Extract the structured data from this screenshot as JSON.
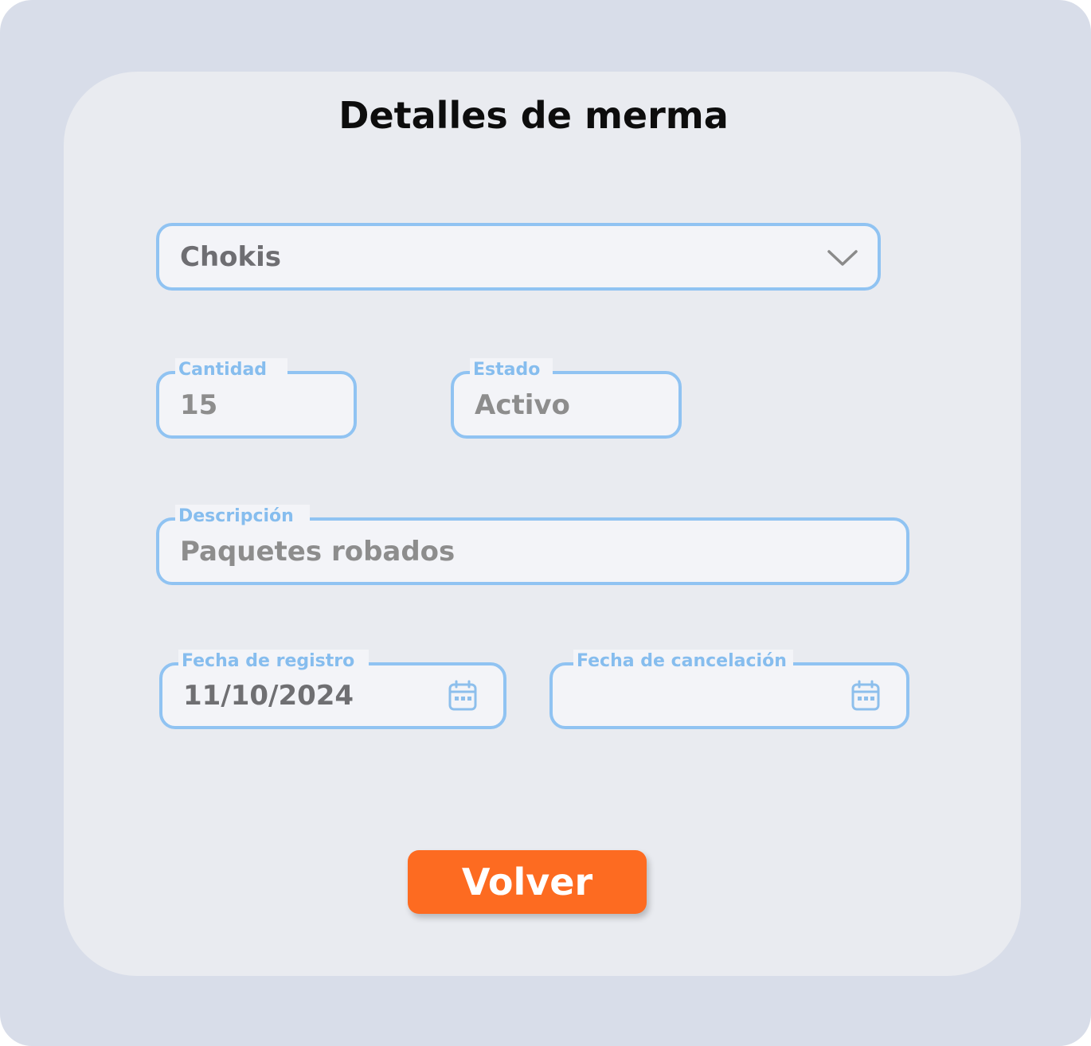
{
  "page": {
    "title": "Detalles de merma"
  },
  "form": {
    "product": {
      "value": "Chokis",
      "icon": "chevron-down-icon"
    },
    "quantity": {
      "label": "Cantidad",
      "value": "15"
    },
    "status": {
      "label": "Estado",
      "value": "Activo"
    },
    "description": {
      "label": "Descripción",
      "value": "Paquetes robados"
    },
    "registration_date": {
      "label": "Fecha de registro",
      "value": "11/10/2024",
      "icon": "calendar-icon"
    },
    "cancellation_date": {
      "label": "Fecha de cancelación",
      "value": "",
      "icon": "calendar-icon"
    }
  },
  "actions": {
    "back_label": "Volver"
  },
  "colors": {
    "outer_background": "#d8dde9",
    "card_background": "#e9ebf0",
    "field_border": "#90c3f2",
    "label_color": "#86bdee",
    "button_background": "#fd6b21",
    "button_text": "#ffffff"
  }
}
